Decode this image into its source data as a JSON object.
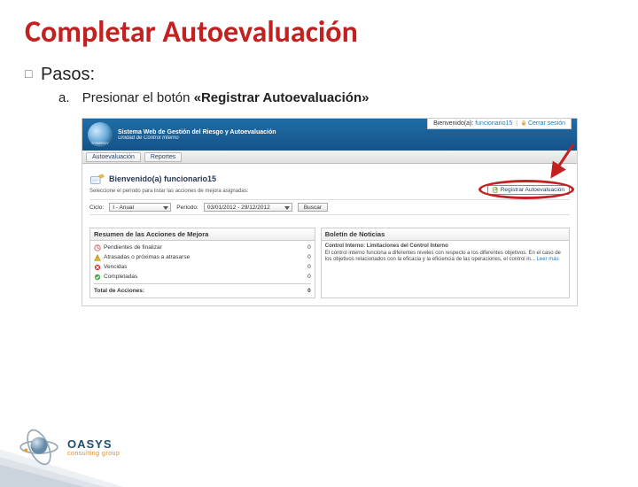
{
  "slide": {
    "title": "Completar Autoevaluación",
    "steps_label": "Pasos:",
    "step_a": {
      "letter": "a.",
      "pre": "Presionar el botón ",
      "bold": "«Registrar Autoevaluación»"
    }
  },
  "app": {
    "synergy_label": "SYNERGY",
    "header_title": "Sistema Web de Gestión del Riesgo y Autoevaluación",
    "header_subtitle": "Unidad de Control Interno",
    "welcome_user_prefix": "Bienvenido(a): ",
    "welcome_user": "funcionario15",
    "logout": "Cerrar sesión",
    "tabs": {
      "autoeval": "Autoevaluación",
      "reportes": "Reportes"
    },
    "welcome_h": "Bienvenido(a) funcionario15",
    "instruction": "Seleccione el período para listar las acciones de mejora asignadas:",
    "registrar_btn": "Registrar Autoevaluación",
    "filters": {
      "ciclo_label": "Ciclo:",
      "ciclo_value": "I - Anual",
      "periodo_label": "Período:",
      "periodo_value": "03/01/2012 - 29/12/2012",
      "buscar": "Buscar"
    },
    "summary": {
      "title": "Resumen de las Acciones de Mejora",
      "rows": [
        {
          "icon": "pending",
          "label": "Pendientes de finalizar",
          "value": "0"
        },
        {
          "icon": "late",
          "label": "Atrasadas o próximas a atrasarse",
          "value": "0"
        },
        {
          "icon": "expired",
          "label": "Vencidas",
          "value": "0"
        },
        {
          "icon": "done",
          "label": "Completadas",
          "value": "0"
        }
      ],
      "total_label": "Total de Acciones:",
      "total_value": "0"
    },
    "news": {
      "title": "Boletín de Noticias",
      "subject": "Control Interno: Limitaciones del Control Interno",
      "body": "El control interno funciona a diferentes niveles con respecto a los diferentes objetivos. En el caso de los objetivos relacionados con la eficacia y la eficiencia de las operaciones, el control in...",
      "more": "Leer más"
    }
  },
  "footer": {
    "brand": "OASYS",
    "tagline": "consulting group"
  }
}
